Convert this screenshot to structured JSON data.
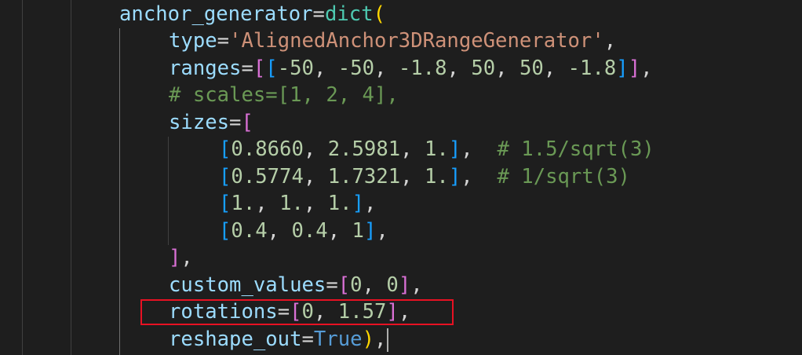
{
  "code": {
    "l1": {
      "a": "anchor_generator",
      "b": "=",
      "c": "dict",
      "d": "("
    },
    "l2": {
      "a": "type",
      "b": "=",
      "c": "'AlignedAnchor3DRangeGenerator'",
      "d": ","
    },
    "l3": {
      "a": "ranges",
      "b": "=",
      "c": "[",
      "d": "[",
      "e": "-50",
      "f": ", ",
      "g": "-50",
      "h": ", ",
      "i": "-1.8",
      "j": ", ",
      "k": "50",
      "l": ", ",
      "m": "50",
      "n": ", ",
      "o": "-1.8",
      "p": "]",
      "q": "]",
      "r": ","
    },
    "l4": {
      "a": "# scales=[1, 2, 4],"
    },
    "l5": {
      "a": "sizes",
      "b": "=",
      "c": "["
    },
    "l6": {
      "a": "[",
      "b": "0.8660",
      "c": ", ",
      "d": "2.5981",
      "e": ", ",
      "f": "1.",
      "g": "]",
      "h": ",  ",
      "i": "# 1.5/sqrt(3)"
    },
    "l7": {
      "a": "[",
      "b": "0.5774",
      "c": ", ",
      "d": "1.7321",
      "e": ", ",
      "f": "1.",
      "g": "]",
      "h": ",  ",
      "i": "# 1/sqrt(3)"
    },
    "l8": {
      "a": "[",
      "b": "1.",
      "c": ", ",
      "d": "1.",
      "e": ", ",
      "f": "1.",
      "g": "]",
      "h": ","
    },
    "l9": {
      "a": "[",
      "b": "0.4",
      "c": ", ",
      "d": "0.4",
      "e": ", ",
      "f": "1",
      "g": "]",
      "h": ","
    },
    "l10": {
      "a": "]",
      "b": ","
    },
    "l11": {
      "a": "custom_values",
      "b": "=",
      "c": "[",
      "d": "0",
      "e": ", ",
      "f": "0",
      "g": "]",
      "h": ","
    },
    "l12": {
      "a": "rotations",
      "b": "=",
      "c": "[",
      "d": "0",
      "e": ", ",
      "f": "1.57",
      "g": "]",
      "h": ","
    },
    "l13": {
      "a": "reshape_out",
      "b": "=",
      "c": "True",
      "d": ")",
      "e": ","
    }
  },
  "colors": {
    "background": "#1e1e1e",
    "highlight_box": "#e81123",
    "variable": "#9cdcfe",
    "string": "#ce9178",
    "number": "#b5cea8",
    "comment": "#6a9955",
    "keyword": "#569cd6",
    "function": "#4ec9b0",
    "bracket_level1": "#ffd700",
    "bracket_level2": "#da70d6",
    "bracket_level3": "#179fff"
  }
}
